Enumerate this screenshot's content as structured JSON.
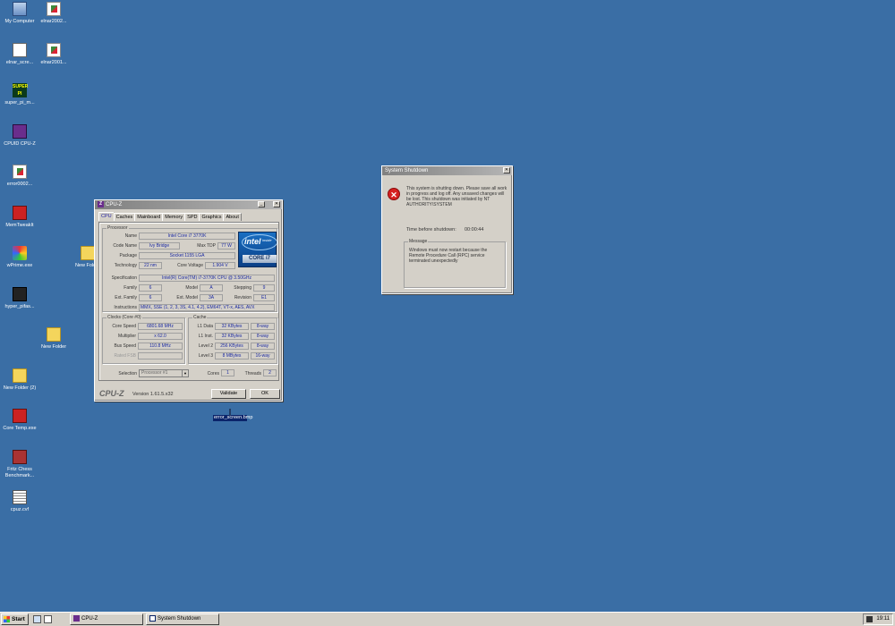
{
  "desktop_icons": [
    {
      "label": "My Computer"
    },
    {
      "label": "elnar2002..."
    },
    {
      "label": "elnar_scre..."
    },
    {
      "label": "elnar2001..."
    },
    {
      "label": "super_pi_m..."
    },
    {
      "label": "CPUID CPU-Z"
    },
    {
      "label": "error0002..."
    },
    {
      "label": "MemTweakIt"
    },
    {
      "label": "wPrime.exe"
    },
    {
      "label": "New Folder"
    },
    {
      "label": "hyper_pifas..."
    },
    {
      "label": "New Folder"
    },
    {
      "label": "New Folder (2)"
    },
    {
      "label": "Core Temp.exe"
    },
    {
      "label": "Fritz Chess Benchmark..."
    },
    {
      "label": "cpuz.cvf"
    }
  ],
  "superpi_icon_text": "SUPER PI",
  "selected_file": {
    "label": "error_screen.bmp"
  },
  "cpuz": {
    "title": "CPU-Z",
    "icon_letter": "Z",
    "tabs": [
      "CPU",
      "Caches",
      "Mainboard",
      "Memory",
      "SPD",
      "Graphics",
      "About"
    ],
    "processor": {
      "group": "Processor",
      "name_label": "Name",
      "name": "Intel Core i7 3770K",
      "codename_label": "Code Name",
      "codename": "Ivy Bridge",
      "maxtdp_label": "Max TDP",
      "maxtdp": "77 W",
      "package_label": "Package",
      "package": "Socket 1155 LGA",
      "technology_label": "Technology",
      "technology": "22 nm",
      "corevoltage_label": "Core Voltage",
      "corevoltage": "1.904 V",
      "spec_label": "Specification",
      "spec": "Intel(R) Core(TM) i7-3770K CPU @ 3.50GHz",
      "family_label": "Family",
      "family": "6",
      "model_label": "Model",
      "model": "A",
      "stepping_label": "Stepping",
      "stepping": "9",
      "extfamily_label": "Ext. Family",
      "extfamily": "6",
      "extmodel_label": "Ext. Model",
      "extmodel": "3A",
      "revision_label": "Revision",
      "revision": "E1",
      "instructions_label": "Instructions",
      "instructions": "MMX, SSE (1, 2, 3, 3S, 4.1, 4.2), EM64T, VT-x, AES, AVX"
    },
    "intel_logo": {
      "brand": "intel",
      "inside": "inside",
      "core": "CORE i7"
    },
    "clocks": {
      "group": "Clocks (Core #0)",
      "corespeed_label": "Core Speed",
      "corespeed": "6801.68 MHz",
      "multiplier_label": "Multiplier",
      "multiplier": "x 62.0",
      "busspeed_label": "Bus Speed",
      "busspeed": "110.8 MHz",
      "ratedfsb_label": "Rated FSB",
      "ratedfsb": ""
    },
    "cache": {
      "group": "Cache",
      "rows": [
        {
          "label": "L1 Data",
          "size": "32 KBytes",
          "way": "8-way"
        },
        {
          "label": "L1 Inst.",
          "size": "32 KBytes",
          "way": "8-way"
        },
        {
          "label": "Level 2",
          "size": "256 KBytes",
          "way": "8-way"
        },
        {
          "label": "Level 3",
          "size": "8 MBytes",
          "way": "16-way"
        }
      ]
    },
    "selection_label": "Selection",
    "selection": "Processor #1",
    "cores_label": "Cores",
    "cores": "1",
    "threads_label": "Threads",
    "threads": "2",
    "brand": "CPU-Z",
    "version": "Version 1.61.5.x32",
    "validate": "Validate",
    "ok": "OK"
  },
  "shutdown": {
    "title": "System Shutdown",
    "text": "This system is shutting down. Please save all work in progress and log off. Any unsaved changes will be lost. This shutdown was initiated by NT AUTHORITY\\SYSTEM",
    "time_label": "Time before shutdown:",
    "time": "00:00:44",
    "message_group": "Message",
    "message": "Windows must now restart because the Remote Procedure Call (RPC) service terminated unexpectedly"
  },
  "taskbar": {
    "start": "Start",
    "tasks": [
      "CPU-Z",
      "System Shutdown"
    ],
    "clock": "19:11"
  }
}
